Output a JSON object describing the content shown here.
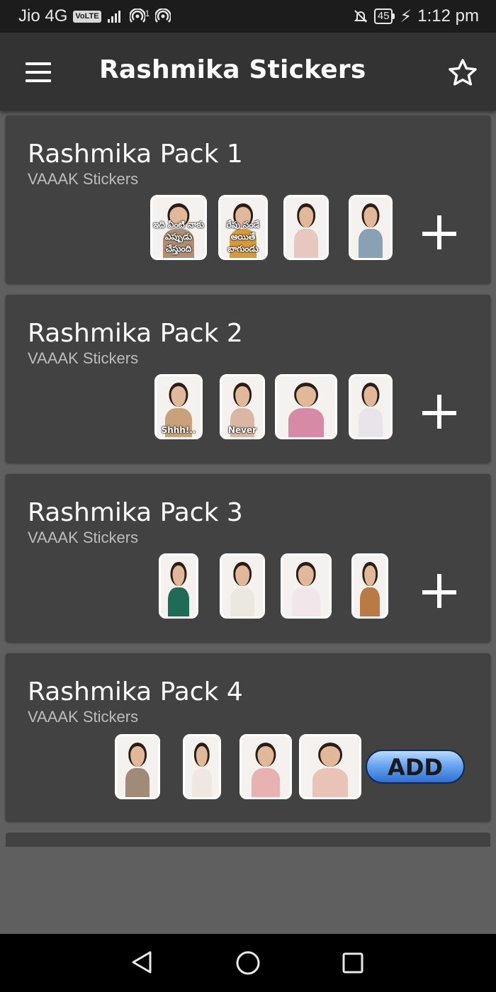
{
  "status_bar": {
    "carrier": "Jio 4G",
    "volte": "VoLTE",
    "hotspot_sup": "1",
    "battery": "45",
    "time": "1:12 pm"
  },
  "app_bar": {
    "title": "Rashmika Stickers",
    "menu_icon": "hamburger-menu-icon",
    "star_icon": "star-outline-icon"
  },
  "packs": [
    {
      "name": "Rashmika Pack 1",
      "publisher": "VAAAK Stickers",
      "action": "plus",
      "stickers": [
        {
          "caption": "ఇది ఏంటి నాకు ఎప్పుడు చేస్తుంది",
          "color": "#b08e74"
        },
        {
          "caption": "రేపు సండే అయితే బాగుండు",
          "color": "#d59a3e"
        },
        {
          "caption": "",
          "color": "#e7c7c0"
        },
        {
          "caption": "",
          "color": "#8aa0b4"
        }
      ]
    },
    {
      "name": "Rashmika Pack 2",
      "publisher": "VAAAK Stickers",
      "action": "plus",
      "stickers": [
        {
          "caption": "Shhh!..",
          "color": "#c9a27d"
        },
        {
          "caption": "Never",
          "color": "#d9b7a2"
        },
        {
          "caption": "",
          "color": "#d78aa6"
        },
        {
          "caption": "",
          "color": "#e9e4ea"
        }
      ]
    },
    {
      "name": "Rashmika Pack 3",
      "publisher": "VAAAK Stickers",
      "action": "plus",
      "stickers": [
        {
          "caption": "",
          "color": "#1f6b55"
        },
        {
          "caption": "",
          "color": "#ece8e0"
        },
        {
          "caption": "",
          "color": "#f1e6ea"
        },
        {
          "caption": "",
          "color": "#b97a45"
        }
      ]
    },
    {
      "name": "Rashmika Pack 4",
      "publisher": "VAAAK Stickers",
      "action": "add",
      "add_label": "ADD",
      "stickers": [
        {
          "caption": "",
          "color": "#a08a78"
        },
        {
          "caption": "",
          "color": "#efe7e2"
        },
        {
          "caption": "",
          "color": "#e8b2b2"
        },
        {
          "caption": "",
          "color": "#e9c2b8"
        }
      ]
    }
  ],
  "nav_bar": {
    "back_icon": "back-triangle-icon",
    "home_icon": "home-circle-icon",
    "recents_icon": "recents-square-icon"
  }
}
